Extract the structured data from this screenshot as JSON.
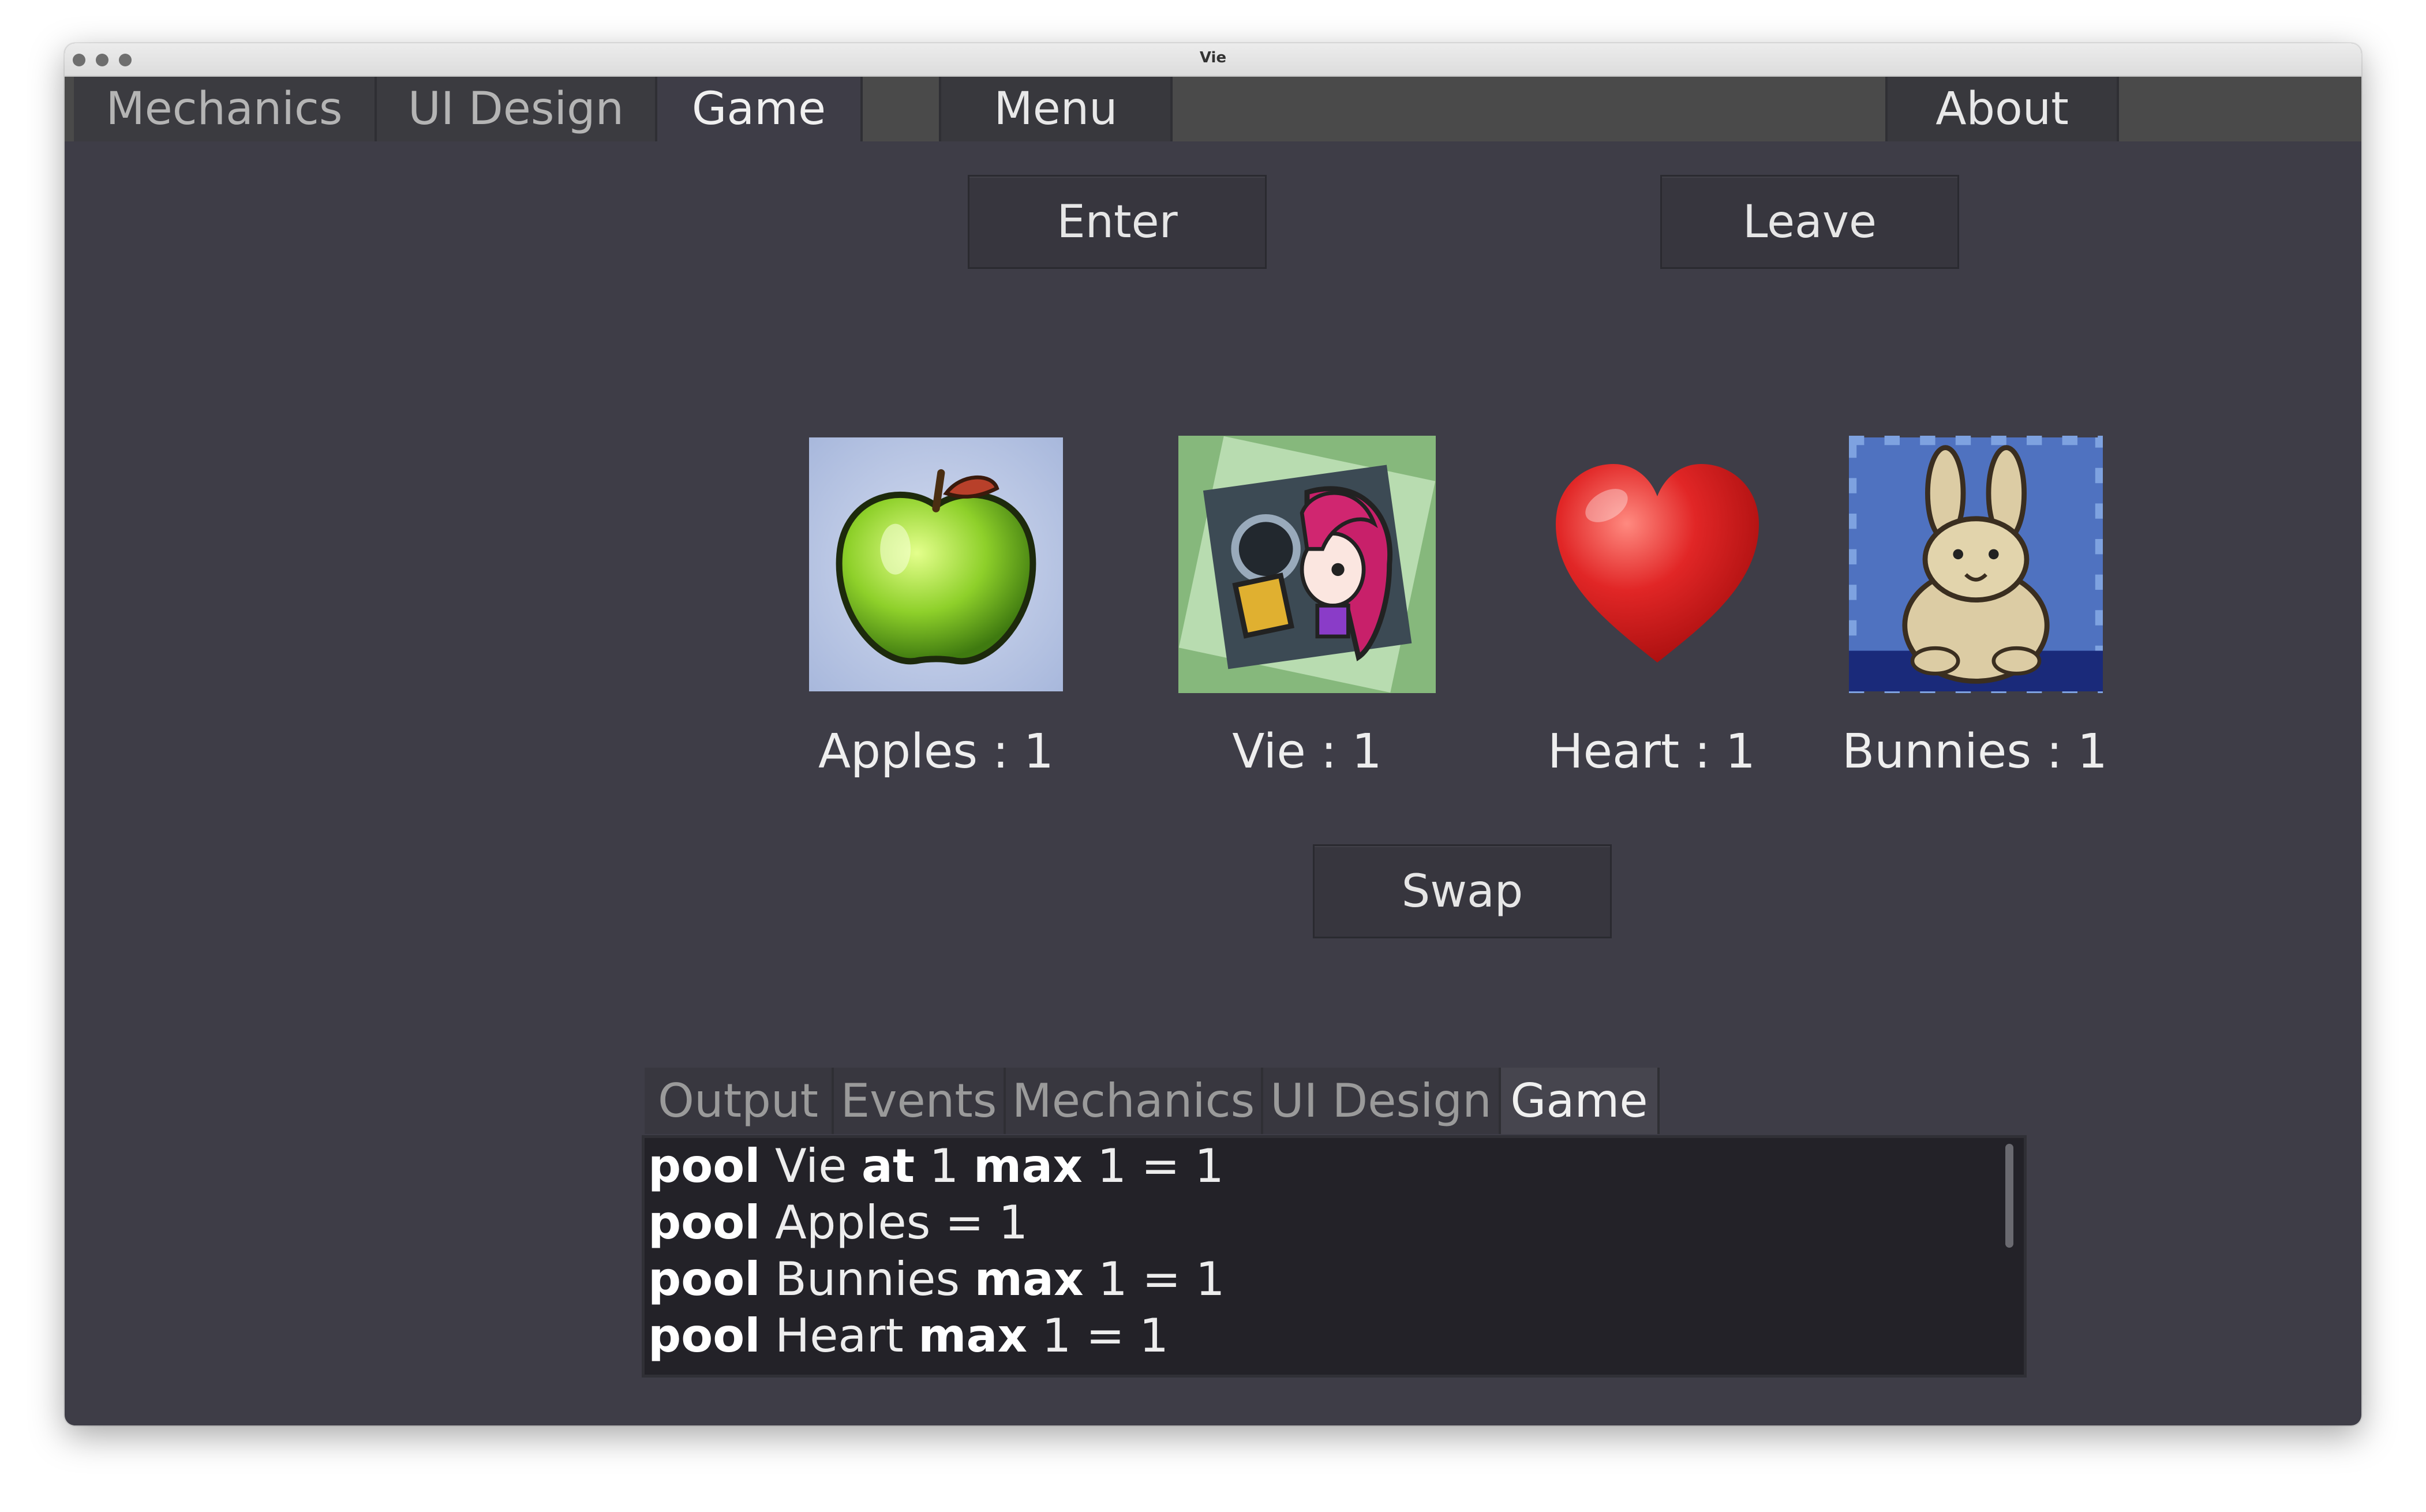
{
  "window": {
    "title": "Vie"
  },
  "menubar": {
    "tabs": [
      {
        "label": "Mechanics"
      },
      {
        "label": "UI Design"
      },
      {
        "label": "Game"
      }
    ],
    "menu_label": "Menu",
    "about_label": "About"
  },
  "actions": {
    "enter_label": "Enter",
    "leave_label": "Leave",
    "swap_label": "Swap"
  },
  "resources": [
    {
      "name": "Apples",
      "count": 1,
      "caption": "Apples : 1",
      "icon": "apple-icon"
    },
    {
      "name": "Vie",
      "count": 1,
      "caption": "Vie : 1",
      "icon": "vie-character-icon"
    },
    {
      "name": "Heart",
      "count": 1,
      "caption": "Heart : 1",
      "icon": "heart-icon"
    },
    {
      "name": "Bunnies",
      "count": 1,
      "caption": "Bunnies : 1",
      "icon": "bunny-icon"
    }
  ],
  "log": {
    "tabs": [
      {
        "label": "Output"
      },
      {
        "label": "Events"
      },
      {
        "label": "Mechanics"
      },
      {
        "label": "UI Design"
      },
      {
        "label": "Game"
      }
    ],
    "lines": [
      {
        "k1": "pool",
        "t1": " Vie ",
        "k2": "at",
        "t2": " 1 ",
        "k3": "max",
        "t3": " 1 = 1"
      },
      {
        "k1": "pool",
        "t1": " Apples = 1",
        "k2": "",
        "t2": "",
        "k3": "",
        "t3": ""
      },
      {
        "k1": "pool",
        "t1": " Bunnies ",
        "k2": "max",
        "t2": " 1 = 1",
        "k3": "",
        "t3": ""
      },
      {
        "k1": "pool",
        "t1": " Heart ",
        "k2": "max",
        "t2": " 1 = 1",
        "k3": "",
        "t3": ""
      }
    ]
  },
  "colors": {
    "background": "#3e3d47",
    "menubar": "#4a4a4a",
    "heart": "#d42a2a",
    "apple": "#8fcf2a"
  }
}
